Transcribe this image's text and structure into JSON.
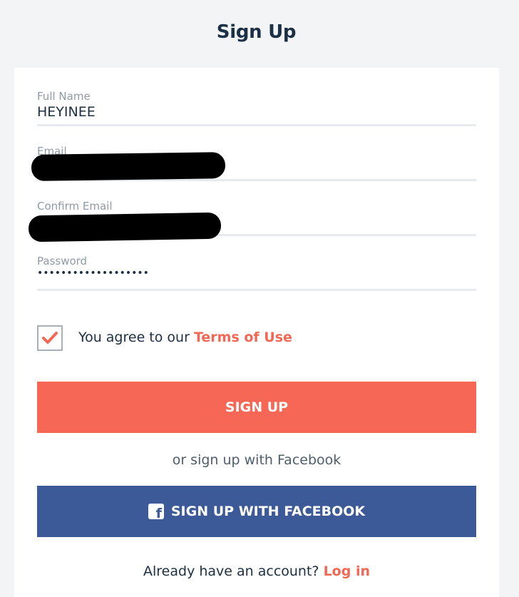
{
  "page": {
    "title": "Sign Up"
  },
  "form": {
    "full_name": {
      "label": "Full Name",
      "value": "HEYINEE"
    },
    "email": {
      "label": "Email",
      "value": ""
    },
    "confirm_email": {
      "label": "Confirm Email",
      "value": ""
    },
    "password": {
      "label": "Password",
      "value": "•••••••••••••••••••"
    },
    "terms": {
      "checked": true,
      "prefix": "You agree to our",
      "link_label": "Terms of Use"
    }
  },
  "buttons": {
    "signup_label": "SIGN UP",
    "divider_text": "or sign up with Facebook",
    "facebook_label": "SIGN UP WITH FACEBOOK",
    "facebook_icon": "facebook-icon"
  },
  "footer": {
    "prompt": "Already have an account?",
    "login_label": "Log in"
  },
  "colors": {
    "background": "#f3f4f6",
    "accent": "#f66855",
    "facebook": "#3c5a98",
    "text": "#1b2f45",
    "label": "#8f9aa6"
  }
}
